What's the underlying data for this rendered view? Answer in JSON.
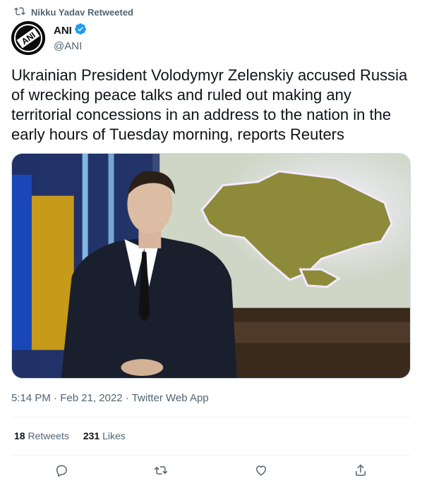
{
  "retweet_header": {
    "text": "Nikku Yadav Retweeted",
    "icon": "retweet-icon"
  },
  "author": {
    "name": "ANI",
    "handle": "@ANI",
    "verified_icon": "verified-badge-icon",
    "verified_color": "#1d9bf0",
    "avatar_logo_text": "ANI"
  },
  "tweet": {
    "text": "Ukrainian President Volodymyr Zelenskiy accused Russia of wrecking peace talks and ruled out making any territorial concessions in an address to the nation in the early hours of Tuesday morning, reports Reuters"
  },
  "meta": {
    "time": "5:14 PM",
    "sep1": " · ",
    "date": "Feb 21, 2022",
    "sep2": " · ",
    "source": "Twitter Web App"
  },
  "stats": {
    "retweets_count": "18",
    "retweets_label": "Retweets",
    "likes_count": "231",
    "likes_label": "Likes"
  },
  "actions": [
    {
      "name": "reply",
      "icon": "reply-icon"
    },
    {
      "name": "retweet",
      "icon": "retweet-icon"
    },
    {
      "name": "like",
      "icon": "heart-icon"
    },
    {
      "name": "share",
      "icon": "share-icon"
    }
  ],
  "colors": {
    "secondary_text": "#536471",
    "primary_text": "#0f1419",
    "divider": "#eff3f4"
  }
}
